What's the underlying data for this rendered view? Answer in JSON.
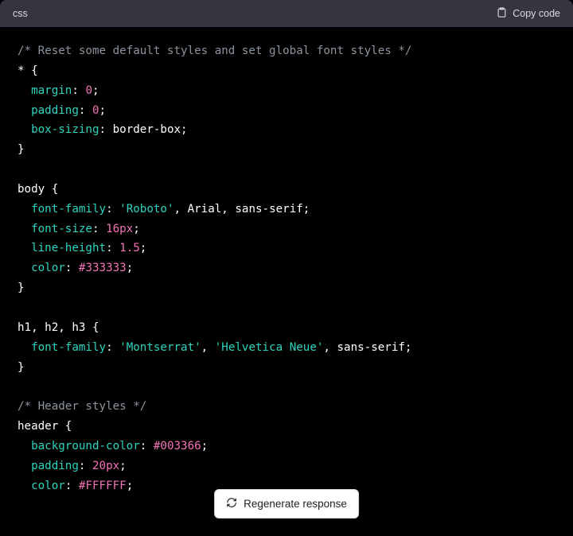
{
  "header": {
    "language": "css",
    "copy_label": "Copy code"
  },
  "code": {
    "comment_reset": "/* Reset some default styles and set global font styles */",
    "sel_star": "* {",
    "prop_margin": "margin",
    "val_margin": "0",
    "prop_padding": "padding",
    "val_padding": "0",
    "prop_boxsizing": "box-sizing",
    "val_boxsizing": "border-box",
    "close1": "}",
    "sel_body": "body {",
    "prop_ff": "font-family",
    "val_ff_roboto": "'Roboto'",
    "val_ff_rest": ", Arial, sans-serif",
    "prop_fs": "font-size",
    "val_fs": "16px",
    "prop_lh": "line-height",
    "val_lh": "1.5",
    "prop_color": "color",
    "val_color_body": "#333333",
    "close2": "}",
    "sel_h": "h1, h2, h3 {",
    "val_ff_mont": "'Montserrat'",
    "val_ff_helv": "'Helvetica Neue'",
    "val_ff_sans": ", sans-serif",
    "close3": "}",
    "comment_header": "/* Header styles */",
    "sel_header": "header {",
    "prop_bg": "background-color",
    "val_bg_header": "#003366",
    "val_padding_header": "20px",
    "val_color_header": "#FFFFFF"
  },
  "footer": {
    "regenerate_label": "Regenerate response"
  }
}
